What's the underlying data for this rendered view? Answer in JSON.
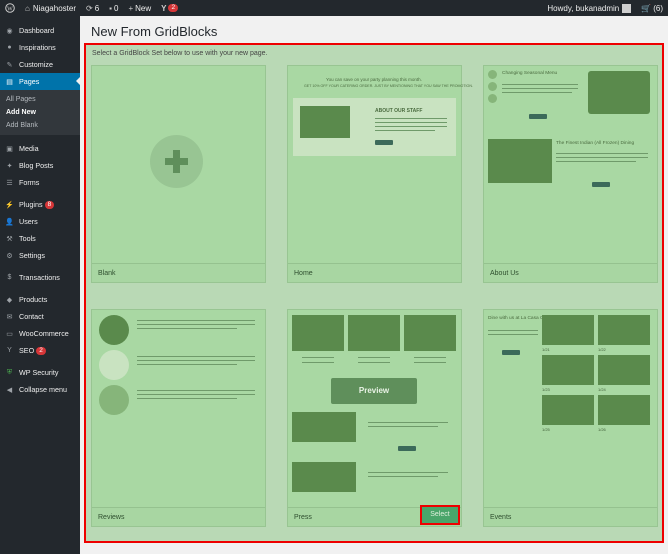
{
  "adminbar": {
    "site_name": "Niagahoster",
    "updates_count": "6",
    "comments_count": "0",
    "new_label": "New",
    "notifications_count": "2",
    "greeting": "Howdy, bukanadmin",
    "cart_count": "(6)"
  },
  "sidebar": {
    "items": [
      {
        "label": "Dashboard",
        "icon": "dashboard-icon"
      },
      {
        "label": "Inspirations",
        "icon": "lightbulb-icon"
      },
      {
        "label": "Customize",
        "icon": "brush-icon"
      },
      {
        "label": "Pages",
        "icon": "pages-icon"
      },
      {
        "label": "Media",
        "icon": "media-icon"
      },
      {
        "label": "Blog Posts",
        "icon": "pin-icon"
      },
      {
        "label": "Forms",
        "icon": "forms-icon"
      },
      {
        "label": "Plugins",
        "icon": "plugin-icon",
        "badge": "8"
      },
      {
        "label": "Users",
        "icon": "user-icon"
      },
      {
        "label": "Tools",
        "icon": "wrench-icon"
      },
      {
        "label": "Settings",
        "icon": "settings-icon"
      },
      {
        "label": "Transactions",
        "icon": "transactions-icon"
      },
      {
        "label": "Products",
        "icon": "products-icon"
      },
      {
        "label": "Contact",
        "icon": "mail-icon"
      },
      {
        "label": "WooCommerce",
        "icon": "woocommerce-icon"
      },
      {
        "label": "SEO",
        "icon": "seo-icon",
        "badge": "2"
      },
      {
        "label": "WP Security",
        "icon": "shield-icon"
      },
      {
        "label": "Collapse menu",
        "icon": "collapse-icon"
      }
    ],
    "submenu": [
      "All Pages",
      "Add New",
      "Add Blank"
    ]
  },
  "page_title": "New From GridBlocks",
  "instruction": "Select a GridBlock Set below to use with your new page.",
  "cards": [
    {
      "label": "Blank"
    },
    {
      "label": "Home"
    },
    {
      "label": "About Us"
    },
    {
      "label": "Reviews"
    },
    {
      "label": "Press"
    },
    {
      "label": "Events"
    }
  ],
  "preview_label": "Preview",
  "select_label": "Select",
  "thumb_text": {
    "home_tagline": "You can save on your party planning this month.",
    "home_sub": "GET 10% OFF YOUR CATERING ORDER. JUST BY MENTIONING THAT YOU SAW THE PROMOTION.",
    "home_heading": "ABOUT OUR STAFF",
    "about_heading1": "Changing Seasonal Menu",
    "about_heading2": "The Finest Indian (All Frozen) Dining",
    "events_heading": "Dine with us at La Casa Colorado",
    "events_captions": [
      "1/21",
      "1/22",
      "1/23",
      "1/24",
      "1/25",
      "1/26"
    ]
  },
  "colors": {
    "adminbar_bg": "#23282d",
    "sidebar_bg": "#23282d",
    "current_item_bg": "#0073aa",
    "highlight_border": "#e00000",
    "overlay_green": "#a8d5a2"
  }
}
